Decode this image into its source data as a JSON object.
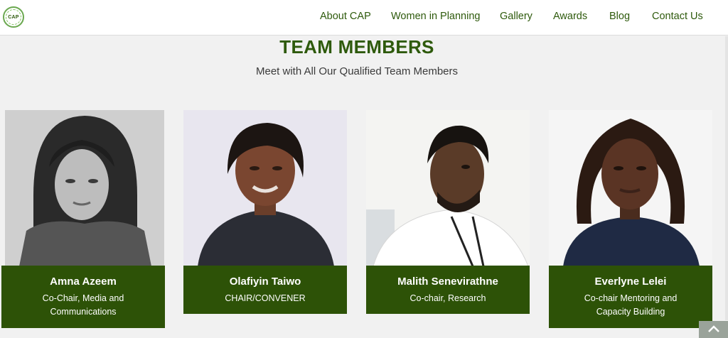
{
  "logo": {
    "text": "CAP"
  },
  "nav": {
    "items": [
      "About CAP",
      "Women in Planning",
      "Gallery",
      "Awards",
      "Blog",
      "Contact Us"
    ]
  },
  "section": {
    "title": "TEAM MEMBERS",
    "subtitle": "Meet with All Our Qualified Team Members"
  },
  "members": [
    {
      "name": "Amna Azeem",
      "role": "Co-Chair, Media and Communications"
    },
    {
      "name": "Olafiyin Taiwo",
      "role": "CHAIR/CONVENER"
    },
    {
      "name": "Malith Senevirathne",
      "role": "Co-chair, Research"
    },
    {
      "name": "Everlyne Lelei",
      "role": "Co-chair Mentoring and Capacity Building"
    }
  ],
  "colors": {
    "brand_green": "#2d5207",
    "nav_text": "#2e5a0c",
    "page_bg": "#f1f1f1"
  },
  "icons": {
    "scroll_top": "chevron-up-icon"
  }
}
